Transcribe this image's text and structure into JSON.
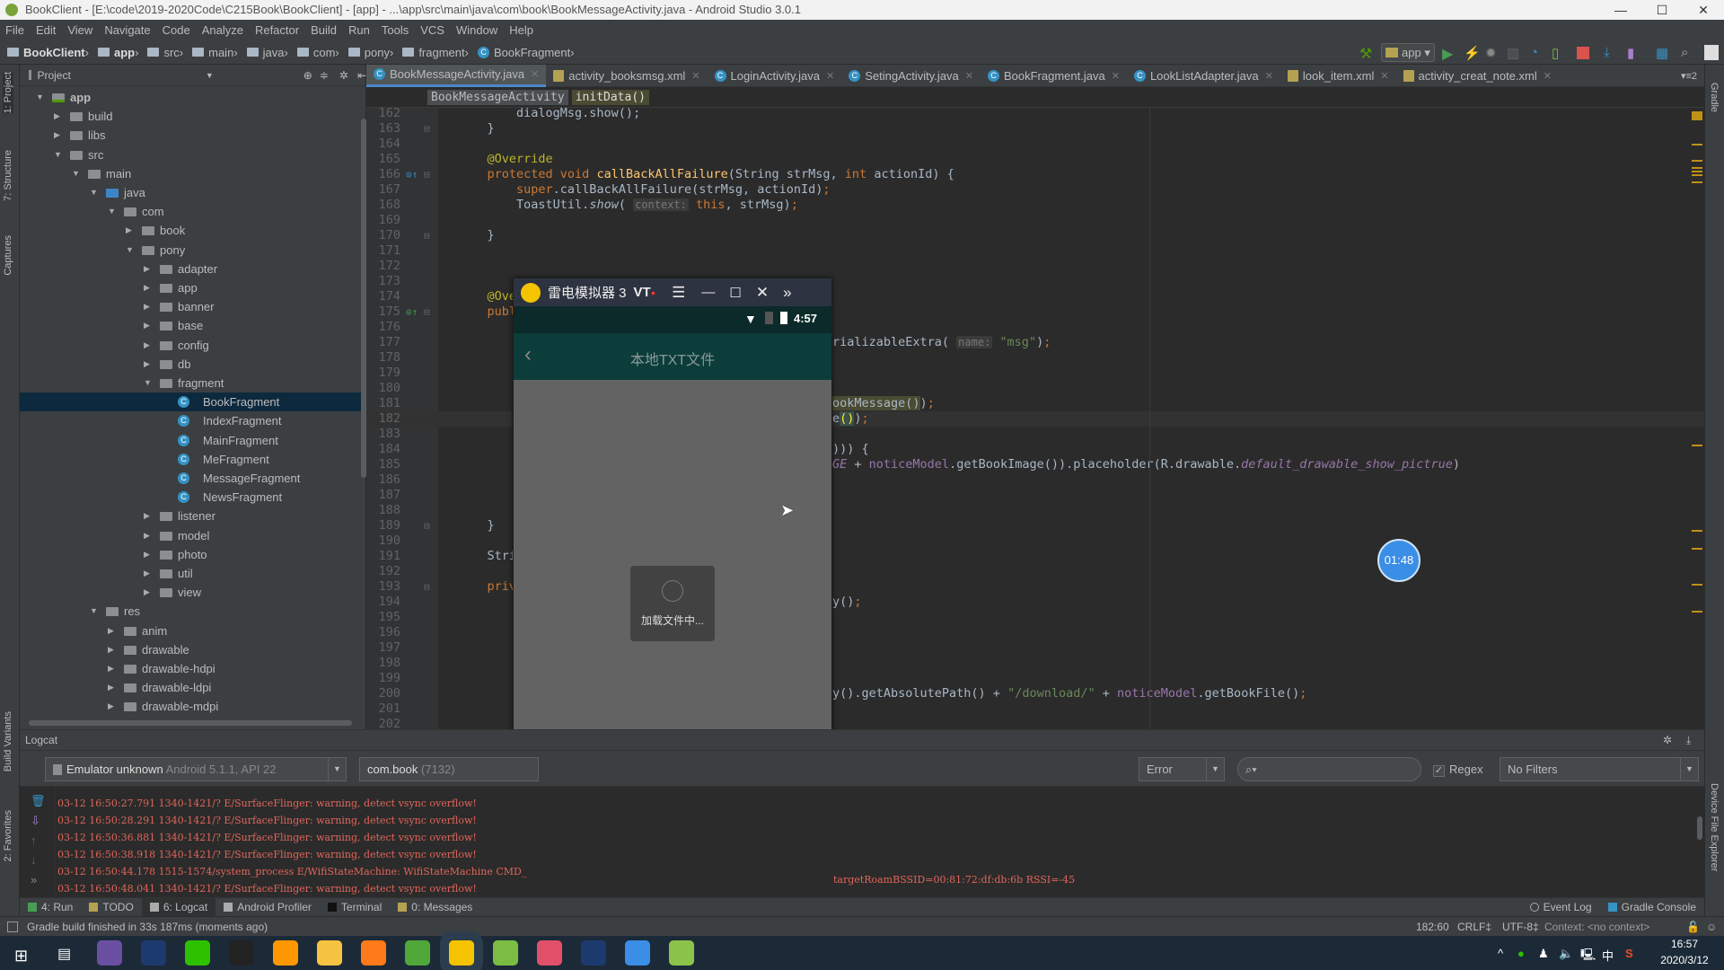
{
  "window": {
    "title": "BookClient - [E:\\code\\2019-2020Code\\C215Book\\BookClient] - [app] - ...\\app\\src\\main\\java\\com\\book\\BookMessageActivity.java - Android Studio 3.0.1",
    "minimize": "—",
    "maximize": "☐",
    "close": "✕"
  },
  "menu": [
    "File",
    "Edit",
    "View",
    "Navigate",
    "Code",
    "Analyze",
    "Refactor",
    "Build",
    "Run",
    "Tools",
    "VCS",
    "Window",
    "Help"
  ],
  "breadcrumb": [
    "BookClient",
    "app",
    "src",
    "main",
    "java",
    "com",
    "pony",
    "fragment",
    "BookFragment"
  ],
  "toolbar": {
    "run_config": "app"
  },
  "left_strip": [
    "1: Project",
    "7: Structure",
    "Captures",
    "Build Variants",
    "2: Favorites"
  ],
  "right_strip": [
    "Gradle",
    "Device File Explorer"
  ],
  "project": {
    "header": "Project",
    "tree": [
      {
        "label": "app",
        "depth": 0,
        "state": "open",
        "type": "module",
        "bold": true
      },
      {
        "label": "build",
        "depth": 1,
        "state": "closed",
        "type": "folder"
      },
      {
        "label": "libs",
        "depth": 1,
        "state": "closed",
        "type": "folder"
      },
      {
        "label": "src",
        "depth": 1,
        "state": "open",
        "type": "folder"
      },
      {
        "label": "main",
        "depth": 2,
        "state": "open",
        "type": "folder"
      },
      {
        "label": "java",
        "depth": 3,
        "state": "open",
        "type": "source"
      },
      {
        "label": "com",
        "depth": 4,
        "state": "open",
        "type": "folder"
      },
      {
        "label": "book",
        "depth": 5,
        "state": "closed",
        "type": "folder"
      },
      {
        "label": "pony",
        "depth": 5,
        "state": "open",
        "type": "folder"
      },
      {
        "label": "adapter",
        "depth": 6,
        "state": "closed",
        "type": "folder"
      },
      {
        "label": "app",
        "depth": 6,
        "state": "closed",
        "type": "folder"
      },
      {
        "label": "banner",
        "depth": 6,
        "state": "closed",
        "type": "folder"
      },
      {
        "label": "base",
        "depth": 6,
        "state": "closed",
        "type": "folder"
      },
      {
        "label": "config",
        "depth": 6,
        "state": "closed",
        "type": "folder"
      },
      {
        "label": "db",
        "depth": 6,
        "state": "closed",
        "type": "folder"
      },
      {
        "label": "fragment",
        "depth": 6,
        "state": "open",
        "type": "folder"
      },
      {
        "label": "BookFragment",
        "depth": 7,
        "state": "leaf",
        "type": "class",
        "selected": true
      },
      {
        "label": "IndexFragment",
        "depth": 7,
        "state": "leaf",
        "type": "class"
      },
      {
        "label": "MainFragment",
        "depth": 7,
        "state": "leaf",
        "type": "class"
      },
      {
        "label": "MeFragment",
        "depth": 7,
        "state": "leaf",
        "type": "class"
      },
      {
        "label": "MessageFragment",
        "depth": 7,
        "state": "leaf",
        "type": "class"
      },
      {
        "label": "NewsFragment",
        "depth": 7,
        "state": "leaf",
        "type": "class"
      },
      {
        "label": "listener",
        "depth": 6,
        "state": "closed",
        "type": "folder"
      },
      {
        "label": "model",
        "depth": 6,
        "state": "closed",
        "type": "folder"
      },
      {
        "label": "photo",
        "depth": 6,
        "state": "closed",
        "type": "folder"
      },
      {
        "label": "util",
        "depth": 6,
        "state": "closed",
        "type": "folder"
      },
      {
        "label": "view",
        "depth": 6,
        "state": "closed",
        "type": "folder"
      },
      {
        "label": "res",
        "depth": 3,
        "state": "open",
        "type": "folder"
      },
      {
        "label": "anim",
        "depth": 4,
        "state": "closed",
        "type": "folder"
      },
      {
        "label": "drawable",
        "depth": 4,
        "state": "closed",
        "type": "folder"
      },
      {
        "label": "drawable-hdpi",
        "depth": 4,
        "state": "closed",
        "type": "folder"
      },
      {
        "label": "drawable-ldpi",
        "depth": 4,
        "state": "closed",
        "type": "folder"
      },
      {
        "label": "drawable-mdpi",
        "depth": 4,
        "state": "closed",
        "type": "folder"
      },
      {
        "label": "drawable-xhdpi",
        "depth": 4,
        "state": "closed",
        "type": "folder"
      }
    ]
  },
  "tabs": [
    {
      "label": "BookMessageActivity.java",
      "type": "class",
      "active": true
    },
    {
      "label": "activity_booksmsg.xml",
      "type": "xml"
    },
    {
      "label": "LoginActivity.java",
      "type": "class"
    },
    {
      "label": "SetingActivity.java",
      "type": "class"
    },
    {
      "label": "BookFragment.java",
      "type": "class"
    },
    {
      "label": "LookListAdapter.java",
      "type": "class"
    },
    {
      "label": "look_item.xml",
      "type": "xml"
    },
    {
      "label": "activity_creat_note.xml",
      "type": "xml"
    }
  ],
  "tabs_overflow": "▾≡2",
  "editor_breadcrumb": [
    "BookMessageActivity",
    "initData()"
  ],
  "code": [
    {
      "n": 162,
      "l": [
        [
          "        dialogMsg.show();",
          ""
        ]
      ]
    },
    {
      "n": 163,
      "l": [
        [
          "    }",
          ""
        ]
      ]
    },
    {
      "n": 164,
      "l": []
    },
    {
      "n": 165,
      "l": [
        [
          "    @Override",
          "an"
        ]
      ]
    },
    {
      "n": 166,
      "l": [
        [
          "    protected void ",
          "kw"
        ],
        [
          "callBackAllFailure",
          "fn"
        ],
        [
          "(String strMsg, ",
          ""
        ],
        [
          "int ",
          "kw"
        ],
        [
          "actionId) {",
          ""
        ]
      ]
    },
    {
      "n": 167,
      "l": [
        [
          "        super",
          "kw"
        ],
        [
          ".callBackAllFailure(strMsg, actionId)",
          ""
        ],
        [
          ";",
          "kw"
        ]
      ]
    },
    {
      "n": 168,
      "l": [
        [
          "        ToastUtil.",
          ""
        ],
        [
          "show",
          "it"
        ],
        [
          "( ",
          ""
        ],
        [
          "context:",
          "hint"
        ],
        [
          " this",
          "kw"
        ],
        [
          ", strMsg)",
          ""
        ],
        [
          ";",
          "kw"
        ]
      ]
    },
    {
      "n": 169,
      "l": []
    },
    {
      "n": 170,
      "l": [
        [
          "    }",
          ""
        ]
      ]
    },
    {
      "n": 171,
      "l": []
    },
    {
      "n": 172,
      "l": []
    },
    {
      "n": 173,
      "l": []
    },
    {
      "n": 174,
      "l": [
        [
          "    @Overri",
          "an"
        ]
      ]
    },
    {
      "n": 175,
      "l": [
        [
          "    public v",
          "kw"
        ]
      ]
    },
    {
      "n": 176,
      "l": []
    },
    {
      "n": 177,
      "l": [
        [
          "        not",
          "fld"
        ]
      ],
      "r": [
        [
          "rializableExtra( ",
          ""
        ],
        [
          "name:",
          "hint"
        ],
        [
          " \"msg\"",
          "str"
        ],
        [
          ")",
          ""
        ],
        [
          ";",
          "kw"
        ]
      ]
    },
    {
      "n": 178,
      "l": []
    },
    {
      "n": 179,
      "l": [
        [
          "        mtv",
          "fld"
        ]
      ]
    },
    {
      "n": 180,
      "l": [
        [
          "        // ",
          "cm"
        ]
      ]
    },
    {
      "n": 181,
      "l": [
        [
          "        mtv",
          "fld"
        ]
      ],
      "r": [
        [
          "ookMessage()",
          "hl"
        ],
        [
          ")",
          ""
        ],
        [
          ";",
          "kw"
        ]
      ]
    },
    {
      "n": 182,
      "l": [
        [
          "        mtv",
          "fld"
        ]
      ],
      "r": [
        [
          "e",
          ""
        ],
        [
          "()",
          "br"
        ],
        [
          ")",
          ""
        ],
        [
          ";",
          "kw"
        ]
      ],
      "current": true
    },
    {
      "n": 183,
      "l": []
    },
    {
      "n": 184,
      "l": [
        [
          "        if (",
          "kw"
        ]
      ],
      "r": [
        [
          "))) {",
          ""
        ]
      ]
    },
    {
      "n": 185,
      "l": [],
      "r": [
        [
          "GE",
          "fldit"
        ],
        [
          " + ",
          ""
        ],
        [
          "noticeModel",
          "fld"
        ],
        [
          ".getBookImage()).placeholder(R.drawable.",
          ""
        ],
        [
          "default_drawable_show_pictrue",
          "fldit"
        ],
        [
          ")",
          ""
        ]
      ]
    },
    {
      "n": 186,
      "l": []
    },
    {
      "n": 187,
      "l": [
        [
          "        }",
          ""
        ]
      ]
    },
    {
      "n": 188,
      "l": []
    },
    {
      "n": 189,
      "l": [
        [
          "    }",
          ""
        ]
      ]
    },
    {
      "n": 190,
      "l": []
    },
    {
      "n": 191,
      "l": [
        [
          "    String a",
          ""
        ]
      ]
    },
    {
      "n": 192,
      "l": []
    },
    {
      "n": 193,
      "l": [
        [
          "    private ",
          "kw"
        ]
      ]
    },
    {
      "n": 194,
      "l": [
        [
          "        File",
          ""
        ]
      ],
      "r": [
        [
          "y()",
          ""
        ],
        [
          ";",
          "kw"
        ]
      ]
    },
    {
      "n": 195,
      "l": [
        [
          "        Stri",
          ""
        ]
      ]
    },
    {
      "n": 196,
      "l": [
        [
          "        File",
          ""
        ]
      ]
    },
    {
      "n": 197,
      "l": [
        [
          "        if (",
          "kw"
        ]
      ]
    },
    {
      "n": 198,
      "l": []
    },
    {
      "n": 199,
      "l": []
    },
    {
      "n": 200,
      "l": [
        [
          "        apkP",
          "fld"
        ]
      ],
      "r": [
        [
          "y().getAbsolutePath() + ",
          ""
        ],
        [
          "\"/download/\"",
          "str"
        ],
        [
          " + ",
          ""
        ],
        [
          "noticeModel",
          "fld"
        ],
        [
          ".getBookFile()",
          ""
        ],
        [
          ";",
          "kw"
        ]
      ]
    },
    {
      "n": 201,
      "l": [
        [
          "        File",
          ""
        ]
      ]
    },
    {
      "n": 202,
      "l": [
        [
          "        if (",
          "kw"
        ]
      ]
    }
  ],
  "emulator": {
    "title": "雷电模拟器 3",
    "vt": "VT",
    "time": "4:57",
    "screen_title": "本地TXT文件",
    "loading_text": "加载文件中..."
  },
  "timer_badge": "01:48",
  "logcat": {
    "title": "Logcat",
    "device": "Emulator unknown",
    "device_detail": "Android 5.1.1, API 22",
    "process": "com.book",
    "process_pid": "(7132)",
    "level": "Error",
    "search_placeholder": "",
    "regex_label": "Regex",
    "regex_checked": true,
    "filter": "No Filters",
    "lines": [
      "03-12 16:50:27.791 1340-1421/? E/SurfaceFlinger: warning, detect vsync overflow!",
      "03-12 16:50:28.291 1340-1421/? E/SurfaceFlinger: warning, detect vsync overflow!",
      "03-12 16:50:36.881 1340-1421/? E/SurfaceFlinger: warning, detect vsync overflow!",
      "03-12 16:50:38.918 1340-1421/? E/SurfaceFlinger: warning, detect vsync overflow!",
      "03-12 16:50:44.178 1515-1574/system_process E/WifiStateMachine: WifiStateMachine CMD_",
      "03-12 16:50:48.041 1340-1421/? E/SurfaceFlinger: warning, detect vsync overflow!"
    ],
    "line5_tail": "targetRoamBSSID=00:81:72:df:db:6b RSSI=-45"
  },
  "bottom_tabs": [
    {
      "label": "4: Run",
      "icon": "run-icon"
    },
    {
      "label": "TODO",
      "icon": "todo-icon"
    },
    {
      "label": "6: Logcat",
      "icon": "logcat-icon",
      "active": true
    },
    {
      "label": "Android Profiler",
      "icon": "profiler-icon"
    },
    {
      "label": "Terminal",
      "icon": "terminal-icon"
    },
    {
      "label": "0: Messages",
      "icon": "messages-icon"
    }
  ],
  "bottom_right_tabs": [
    {
      "label": "Event Log"
    },
    {
      "label": "Gradle Console"
    }
  ],
  "status": {
    "message": "Gradle build finished in 33s 187ms (moments ago)",
    "position": "182:60",
    "line_sep": "CRLF‡",
    "encoding": "UTF-8‡",
    "context": "Context: <no context>"
  },
  "taskbar": {
    "time": "16:57",
    "date": "2020/3/12",
    "ime": "中",
    "apps": [
      {
        "name": "eclipse",
        "color": "#6b4fa3"
      },
      {
        "name": "app-8",
        "color": "#1d3a6e"
      },
      {
        "name": "wechat",
        "color": "#2dc100"
      },
      {
        "name": "qq",
        "color": "#222222"
      },
      {
        "name": "sublime",
        "color": "#ff9800"
      },
      {
        "name": "file-explorer",
        "color": "#f6c342"
      },
      {
        "name": "uc-browser",
        "color": "#ff7a1a"
      },
      {
        "name": "green-app",
        "color": "#51a83a"
      },
      {
        "name": "ldplayer",
        "color": "#f5c400"
      },
      {
        "name": "android-studio",
        "color": "#7bbd42"
      },
      {
        "name": "pink-app",
        "color": "#e05068"
      },
      {
        "name": "app-8-b",
        "color": "#1d3a6e"
      },
      {
        "name": "baidu-netdisk",
        "color": "#3a8ee6"
      },
      {
        "name": "notepad",
        "color": "#8bc34a"
      }
    ]
  }
}
